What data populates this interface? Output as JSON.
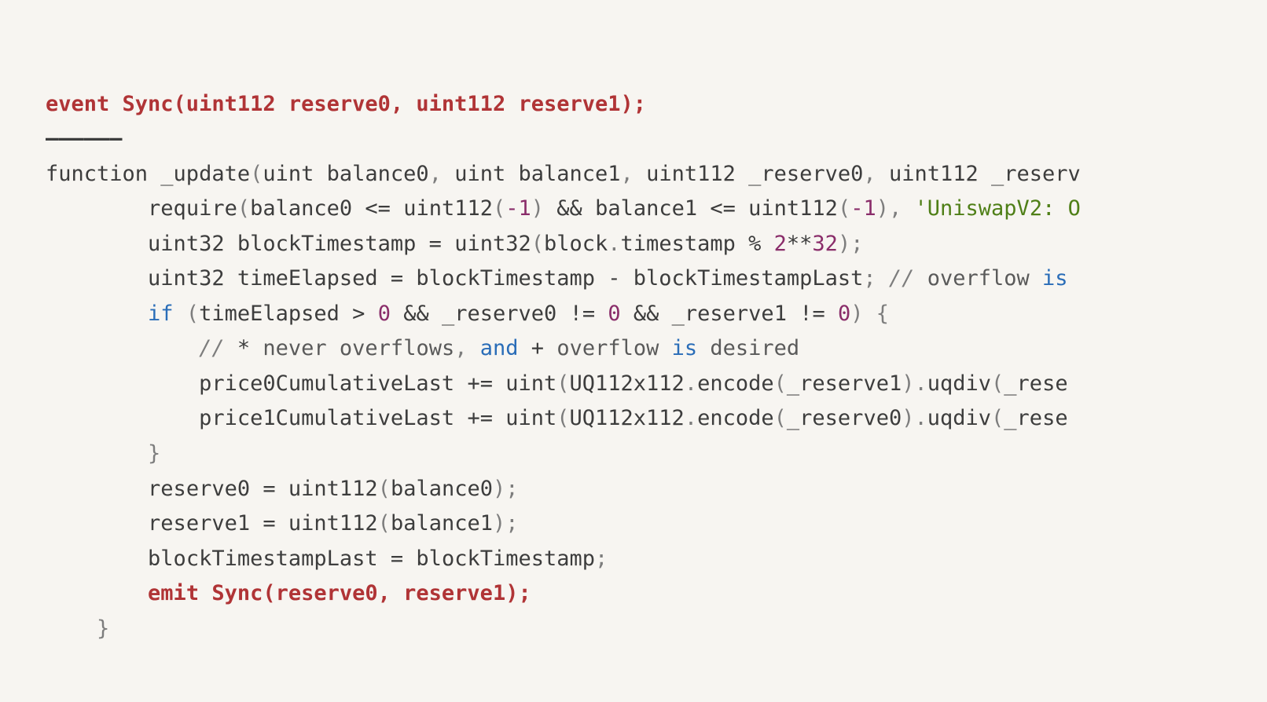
{
  "code": {
    "l1": "event Sync(uint112 reserve0, uint112 reserve1);",
    "l2": "——————",
    "l3_a": "function _update",
    "l3_b": "uint balance0",
    "l3_c": "uint balance1",
    "l3_d": "uint112 _reserve0",
    "l3_e": "uint112 _reserv",
    "l4_a": "require",
    "l4_b": "balance0 ",
    "l4_c": " uint112",
    "l4_d": "-1",
    "l4_e": " balance1 ",
    "l4_f": " uint112",
    "l4_g": "-1",
    "l4_h": "'UniswapV2: O",
    "l5_a": "uint32 blockTimestamp ",
    "l5_b": " uint32",
    "l5_c": "block",
    "l5_d": "timestamp ",
    "l5_e": "2",
    "l5_f": "32",
    "l6_a": "uint32 timeElapsed ",
    "l6_b": " blockTimestamp ",
    "l6_c": " blockTimestampLast",
    "l6_d": "// ",
    "l6_e": "overflow ",
    "l6_f": "is",
    "l7_a": "if",
    "l7_b": "timeElapsed ",
    "l7_c": "0",
    "l7_d": " _reserve0 ",
    "l7_e": "0",
    "l7_f": " _reserve1 ",
    "l7_g": "0",
    "l8_a": "// ",
    "l8_b": "*",
    "l8_c": " never overflows",
    "l8_d": "and",
    "l8_e": "+",
    "l8_f": " overflow ",
    "l8_g": "is",
    "l8_h": " desired",
    "l9_a": "price0CumulativeLast ",
    "l9_b": " uint",
    "l9_c": "UQ112x112",
    "l9_d": "encode",
    "l9_e": "_reserve1",
    "l9_f": "uqdiv",
    "l9_g": "_rese",
    "l10_a": "price1CumulativeLast ",
    "l10_b": " uint",
    "l10_c": "UQ112x112",
    "l10_d": "encode",
    "l10_e": "_reserve0",
    "l10_f": "uqdiv",
    "l10_g": "_rese",
    "l11": "}",
    "l12_a": "reserve0 ",
    "l12_b": " uint112",
    "l12_c": "balance0",
    "l13_a": "reserve1 ",
    "l13_b": " uint112",
    "l13_c": "balance1",
    "l14_a": "blockTimestampLast ",
    "l14_b": " blockTimestamp",
    "l15": "emit Sync(reserve0, reserve1);",
    "l16": "}"
  },
  "op": {
    "lte": "<=",
    "amp2": "&&",
    "eq": "=",
    "pct": "%",
    "pow": "**",
    "minus": "-",
    "gt": ">",
    "neq": "!=",
    "peq": "+=",
    "comma": ",",
    "dot": ".",
    "lp": "(",
    "rp": ")",
    "sc": ";",
    "lb": "{",
    "rb": "}",
    "sp": " "
  },
  "indent": {
    "i1": "    ",
    "i2": "        ",
    "i3": "            "
  }
}
